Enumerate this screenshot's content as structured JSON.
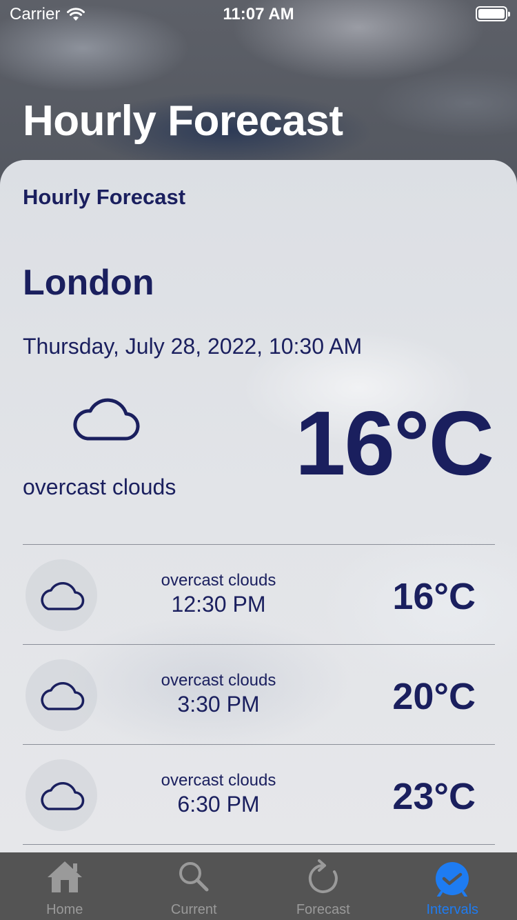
{
  "status_bar": {
    "carrier": "Carrier",
    "time": "11:07 AM"
  },
  "header": {
    "large_title": "Hourly Forecast"
  },
  "card": {
    "title": "Hourly Forecast",
    "city": "London",
    "datetime": "Thursday, July 28, 2022, 10:30 AM",
    "current": {
      "icon": "cloud-icon",
      "description": "overcast clouds",
      "temperature": "16°C"
    },
    "intervals": [
      {
        "icon": "cloud-icon",
        "description": "overcast clouds",
        "time": "12:30 PM",
        "temperature": "16°C"
      },
      {
        "icon": "cloud-icon",
        "description": "overcast clouds",
        "time": "3:30 PM",
        "temperature": "20°C"
      },
      {
        "icon": "cloud-icon",
        "description": "overcast clouds",
        "time": "6:30 PM",
        "temperature": "23°C"
      }
    ]
  },
  "tab_bar": {
    "tabs": [
      {
        "label": "Home",
        "icon": "house-icon",
        "active": false
      },
      {
        "label": "Current",
        "icon": "magnifier-icon",
        "active": false
      },
      {
        "label": "Forecast",
        "icon": "refresh-icon",
        "active": false
      },
      {
        "label": "Intervals",
        "icon": "clock-check-icon",
        "active": true
      }
    ]
  },
  "colors": {
    "text_navy": "#1a1f5e",
    "tab_active": "#1e7cf2",
    "tab_inactive": "#9a9a9a",
    "tab_bar_bg": "#545454"
  }
}
